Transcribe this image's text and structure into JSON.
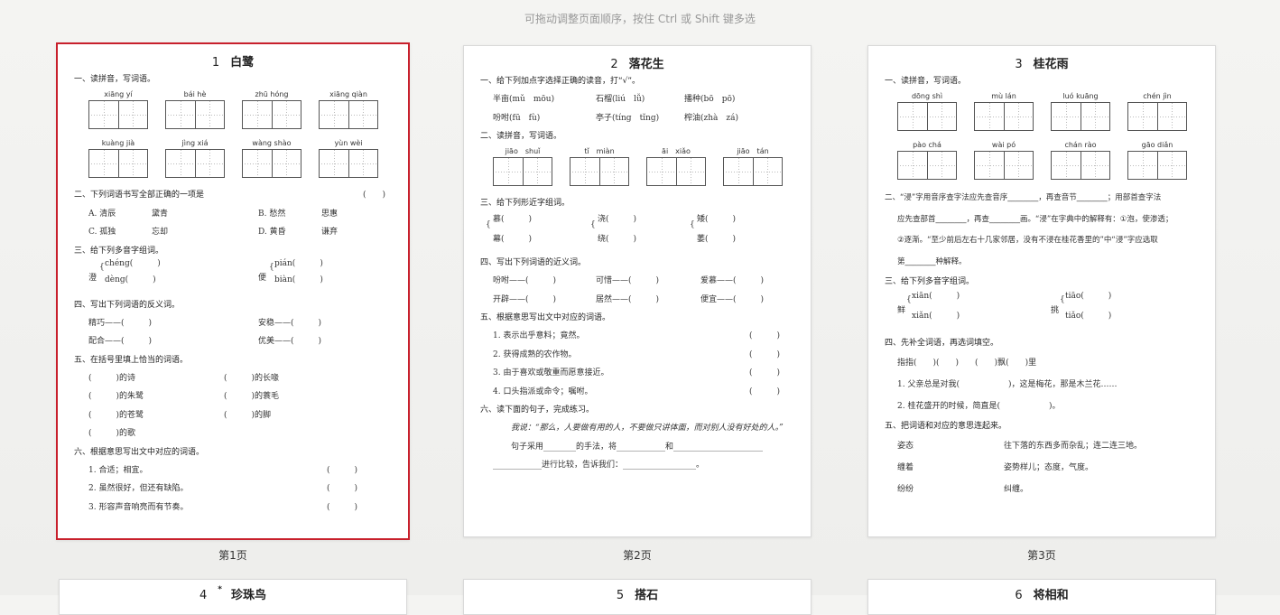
{
  "hint": "可拖动调整页面顺序，按住 Ctrl 或 Shift 键多选",
  "captions": [
    "第1页",
    "第2页",
    "第3页"
  ],
  "p1": {
    "num": "1",
    "title": "白鹭",
    "s1": "一、读拼音，写词语。",
    "py_row1": [
      "xiāng yí",
      "bái hè",
      "zhū hóng",
      "xiāng qiàn"
    ],
    "py_row2": [
      "kuàng jià",
      "jìng xiá",
      "wàng shào",
      "yùn wèi"
    ],
    "s2": "二、下列词语书写全部正确的一项是",
    "s2_paren": "(　　)",
    "opt": [
      "A. 清辰",
      "黛青",
      "B. 愁然",
      "思惠",
      "C. 孤独",
      "忘却",
      "D. 黄昏",
      "谦弃"
    ],
    "s3": "三、给下列多音字组词。",
    "dy": [
      "澄",
      "chéng(　　　)",
      "dèng(　　　)",
      "便",
      "pián(　　　)",
      "biàn(　　　)"
    ],
    "s4": "四、写出下列词语的反义词。",
    "fy": [
      "精巧——(　　　)",
      "安稳——(　　　)",
      "配合——(　　　)",
      "优美——(　　　)"
    ],
    "s5": "五、在括号里填上恰当的词语。",
    "tk": [
      "(　　　)的诗",
      "(　　　)的长喙",
      "(　　　)的朱鹭",
      "(　　　)的蓑毛",
      "(　　　)的苍鹭",
      "(　　　)的脚",
      "(　　　)的歌"
    ],
    "s6": "六、根据意思写出文中对应的词语。",
    "yy": [
      "1. 合适；相宜。",
      "2. 虽然很好，但还有缺陷。",
      "3. 形容声音响亮而有节奏。"
    ],
    "paren": "(　　　)"
  },
  "p2": {
    "num": "2",
    "title": "落花生",
    "s1": "一、给下列加点字选择正确的读音，打“√”。",
    "r1": [
      "半亩(mǔ　mōu)",
      "石榴(liú　lǚ)",
      "播种(bō　pō)",
      "吩咐(fū　fù)",
      "亭子(tíng　tǐng)",
      "榨油(zhà　zá)"
    ],
    "s2": "二、读拼音，写词语。",
    "py": [
      "jiāo　shuǐ",
      "tǐ　miàn",
      "āi　xiǎo",
      "jiāo　tán"
    ],
    "s3": "三、给下列形近字组词。",
    "xj": [
      "慕(　　　)",
      "浇(　　　)",
      "矮(　　　)",
      "幕(　　　)",
      "绕(　　　)",
      "萎(　　　)"
    ],
    "s4": "四、写出下列词语的近义词。",
    "jy": [
      "吩咐——(　　　)",
      "可惜——(　　　)",
      "爱慕——(　　　)",
      "开辟——(　　　)",
      "居然——(　　　)",
      "便宜——(　　　)"
    ],
    "s5": "五、根据意思写出文中对应的词语。",
    "yy": [
      "1. 表示出乎意料；竟然。",
      "2. 获得成熟的农作物。",
      "3. 由于喜欢或敬重而愿意接近。",
      "4. 口头指派或命令；嘱咐。"
    ],
    "paren": "(　　　)",
    "s6": "六、读下面的句子，完成练习。",
    "quote": "我说：“那么，人要做有用的人，不要做只讲体面，而对别人没有好处的人。”",
    "q1": "句子采用________的手法，将____________和______________________",
    "q2": "____________进行比较，告诉我们：__________________。"
  },
  "p3": {
    "num": "3",
    "title": "桂花雨",
    "s1": "一、读拼音，写词语。",
    "py_row1": [
      "dōng shì",
      "mù lán",
      "luó kuāng",
      "chén jìn"
    ],
    "py_row2": [
      "pào chá",
      "wài pó",
      "chán rào",
      "gāo diǎn"
    ],
    "s2a": "二、“浸”字用音序查字法应先查音序________，再查音节________；用部首查字法",
    "s2b": "应先查部首________，再查________画。“浸”在字典中的解释有：①泡，使渗透；",
    "s2c": "②逐渐。“至少前后左右十几家邻居，没有不浸在桂花香里的”中“浸”字应选取",
    "s2d": "第________种解释。",
    "s3": "三、给下列多音字组词。",
    "dy": [
      "鲜",
      "xiān(　　　)",
      "xiǎn(　　　)",
      "挑",
      "tiāo(　　　)",
      "tiǎo(　　　)"
    ],
    "s4": "四、先补全词语，再选词填空。",
    "bq": "指指(　　)(　　)　　(　　)飘(　　)里",
    "l1": "1. 父亲总是对我(　　　　　　)，这是梅花，那是木兰花……",
    "l2": "2. 桂花盛开的时候，简直是(　　　　　　)。",
    "s5": "五、把词语和对应的意思连起来。",
    "lx": [
      "姿态",
      "往下落的东西多而杂乱；连二连三地。",
      "缠着",
      "姿势样儿；态度，气度。",
      "纷纷",
      "纠缠。"
    ]
  },
  "row2": [
    {
      "num": "4",
      "sup": "*",
      "title": "珍珠鸟"
    },
    {
      "num": "5",
      "title": "搭石"
    },
    {
      "num": "6",
      "title": "将相和"
    }
  ]
}
